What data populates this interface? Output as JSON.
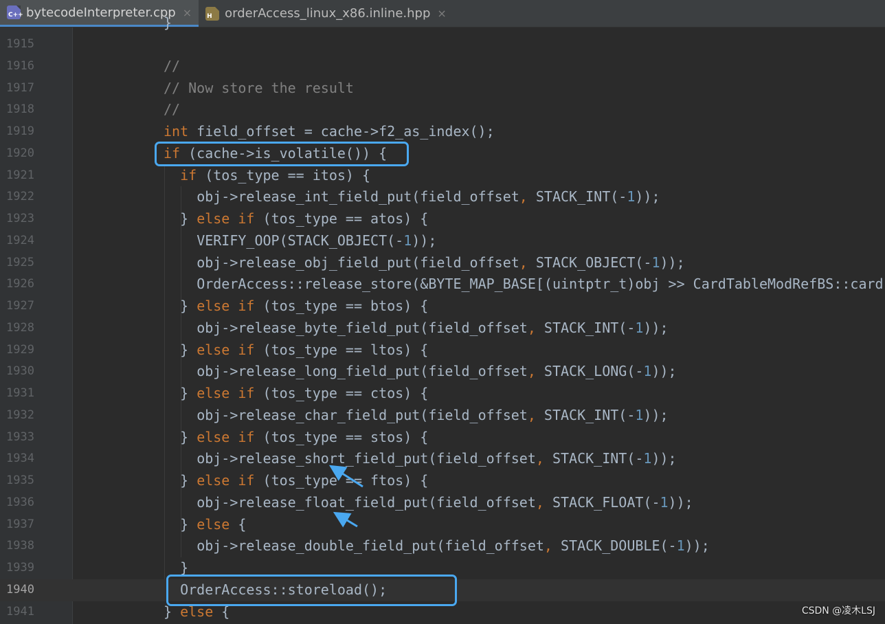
{
  "tabs": [
    {
      "label": "bytecodeInterpreter.cpp",
      "icon": "cpp-file-icon",
      "icon_text": "C++",
      "active": true
    },
    {
      "label": "orderAccess_linux_x86.inline.hpp",
      "icon": "hpp-file-icon",
      "icon_text": "H",
      "active": false
    }
  ],
  "close_glyph": "×",
  "partial_top_line": "}",
  "lines": [
    {
      "num": "1915",
      "indent": 0,
      "tokens": []
    },
    {
      "num": "1916",
      "indent": 0,
      "tokens": [
        {
          "t": "//",
          "c": "c"
        }
      ]
    },
    {
      "num": "1917",
      "indent": 0,
      "tokens": [
        {
          "t": "// Now store the result",
          "c": "c"
        }
      ]
    },
    {
      "num": "1918",
      "indent": 0,
      "tokens": [
        {
          "t": "//",
          "c": "c"
        }
      ]
    },
    {
      "num": "1919",
      "indent": 0,
      "tokens": [
        {
          "t": "int",
          "c": "k"
        },
        {
          "t": " field_offset = cache->f2_as_index();",
          "c": ""
        }
      ]
    },
    {
      "num": "1920",
      "indent": 0,
      "tokens": [
        {
          "t": "if",
          "c": "k"
        },
        {
          "t": " (cache->is_volatile()) {",
          "c": ""
        }
      ]
    },
    {
      "num": "1921",
      "indent": 2,
      "tokens": [
        {
          "t": "if",
          "c": "k"
        },
        {
          "t": " (tos_type == itos) {",
          "c": ""
        }
      ]
    },
    {
      "num": "1922",
      "indent": 4,
      "tokens": [
        {
          "t": "obj->release_int_field_put(field_offset",
          "c": ""
        },
        {
          "t": ",",
          "c": "k"
        },
        {
          "t": " STACK_INT(-",
          "c": ""
        },
        {
          "t": "1",
          "c": "n"
        },
        {
          "t": "));",
          "c": ""
        }
      ]
    },
    {
      "num": "1923",
      "indent": 2,
      "tokens": [
        {
          "t": "} ",
          "c": ""
        },
        {
          "t": "else if",
          "c": "k"
        },
        {
          "t": " (tos_type == atos) {",
          "c": ""
        }
      ]
    },
    {
      "num": "1924",
      "indent": 4,
      "tokens": [
        {
          "t": "VERIFY_OOP(STACK_OBJECT(-",
          "c": ""
        },
        {
          "t": "1",
          "c": "n"
        },
        {
          "t": "));",
          "c": ""
        }
      ]
    },
    {
      "num": "1925",
      "indent": 4,
      "tokens": [
        {
          "t": "obj->release_obj_field_put(field_offset",
          "c": ""
        },
        {
          "t": ",",
          "c": "k"
        },
        {
          "t": " STACK_OBJECT(-",
          "c": ""
        },
        {
          "t": "1",
          "c": "n"
        },
        {
          "t": "));",
          "c": ""
        }
      ]
    },
    {
      "num": "1926",
      "indent": 4,
      "tokens": [
        {
          "t": "OrderAccess::release_store(&BYTE_MAP_BASE[(uintptr_t)obj >> CardTableModRefBS::card",
          "c": ""
        }
      ]
    },
    {
      "num": "1927",
      "indent": 2,
      "tokens": [
        {
          "t": "} ",
          "c": ""
        },
        {
          "t": "else if",
          "c": "k"
        },
        {
          "t": " (tos_type == btos) {",
          "c": ""
        }
      ]
    },
    {
      "num": "1928",
      "indent": 4,
      "tokens": [
        {
          "t": "obj->release_byte_field_put(field_offset",
          "c": ""
        },
        {
          "t": ",",
          "c": "k"
        },
        {
          "t": " STACK_INT(-",
          "c": ""
        },
        {
          "t": "1",
          "c": "n"
        },
        {
          "t": "));",
          "c": ""
        }
      ]
    },
    {
      "num": "1929",
      "indent": 2,
      "tokens": [
        {
          "t": "} ",
          "c": ""
        },
        {
          "t": "else if",
          "c": "k"
        },
        {
          "t": " (tos_type == ltos) {",
          "c": ""
        }
      ]
    },
    {
      "num": "1930",
      "indent": 4,
      "tokens": [
        {
          "t": "obj->release_long_field_put(field_offset",
          "c": ""
        },
        {
          "t": ",",
          "c": "k"
        },
        {
          "t": " STACK_LONG(-",
          "c": ""
        },
        {
          "t": "1",
          "c": "n"
        },
        {
          "t": "));",
          "c": ""
        }
      ]
    },
    {
      "num": "1931",
      "indent": 2,
      "tokens": [
        {
          "t": "} ",
          "c": ""
        },
        {
          "t": "else if",
          "c": "k"
        },
        {
          "t": " (tos_type == ctos) {",
          "c": ""
        }
      ]
    },
    {
      "num": "1932",
      "indent": 4,
      "tokens": [
        {
          "t": "obj->release_char_field_put(field_offset",
          "c": ""
        },
        {
          "t": ",",
          "c": "k"
        },
        {
          "t": " STACK_INT(-",
          "c": ""
        },
        {
          "t": "1",
          "c": "n"
        },
        {
          "t": "));",
          "c": ""
        }
      ]
    },
    {
      "num": "1933",
      "indent": 2,
      "tokens": [
        {
          "t": "} ",
          "c": ""
        },
        {
          "t": "else if",
          "c": "k"
        },
        {
          "t": " (tos_type == stos) {",
          "c": ""
        }
      ]
    },
    {
      "num": "1934",
      "indent": 4,
      "tokens": [
        {
          "t": "obj->release_short_field_put(field_offset",
          "c": ""
        },
        {
          "t": ",",
          "c": "k"
        },
        {
          "t": " STACK_INT(-",
          "c": ""
        },
        {
          "t": "1",
          "c": "n"
        },
        {
          "t": "));",
          "c": ""
        }
      ]
    },
    {
      "num": "1935",
      "indent": 2,
      "tokens": [
        {
          "t": "} ",
          "c": ""
        },
        {
          "t": "else if",
          "c": "k"
        },
        {
          "t": " (tos_type == ftos) {",
          "c": ""
        }
      ]
    },
    {
      "num": "1936",
      "indent": 4,
      "tokens": [
        {
          "t": "obj->release_float_field_put(field_offset",
          "c": ""
        },
        {
          "t": ",",
          "c": "k"
        },
        {
          "t": " STACK_FLOAT(-",
          "c": ""
        },
        {
          "t": "1",
          "c": "n"
        },
        {
          "t": "));",
          "c": ""
        }
      ]
    },
    {
      "num": "1937",
      "indent": 2,
      "tokens": [
        {
          "t": "} ",
          "c": ""
        },
        {
          "t": "else",
          "c": "k"
        },
        {
          "t": " {",
          "c": ""
        }
      ]
    },
    {
      "num": "1938",
      "indent": 4,
      "tokens": [
        {
          "t": "obj->release_double_field_put(field_offset",
          "c": ""
        },
        {
          "t": ",",
          "c": "k"
        },
        {
          "t": " STACK_DOUBLE(-",
          "c": ""
        },
        {
          "t": "1",
          "c": "n"
        },
        {
          "t": "));",
          "c": ""
        }
      ]
    },
    {
      "num": "1939",
      "indent": 2,
      "tokens": [
        {
          "t": "}",
          "c": ""
        }
      ]
    },
    {
      "num": "1940",
      "indent": 2,
      "tokens": [
        {
          "t": "OrderAccess::storeload();",
          "c": ""
        }
      ],
      "current": true
    },
    {
      "num": "1941",
      "indent": 0,
      "tokens": [
        {
          "t": "} ",
          "c": ""
        },
        {
          "t": "else",
          "c": "k"
        },
        {
          "t": " {",
          "c": ""
        }
      ]
    }
  ],
  "annotations": {
    "highlight_color": "#4aa8f0",
    "highlighted_lines": [
      "1920",
      "1940"
    ],
    "arrow_count": 2
  },
  "colors": {
    "background": "#2b2b2b",
    "keyword": "#cc7832",
    "comment": "#808080",
    "number": "#6897bb",
    "text": "#a9b7c6"
  },
  "watermark": "CSDN @凌木LSJ"
}
